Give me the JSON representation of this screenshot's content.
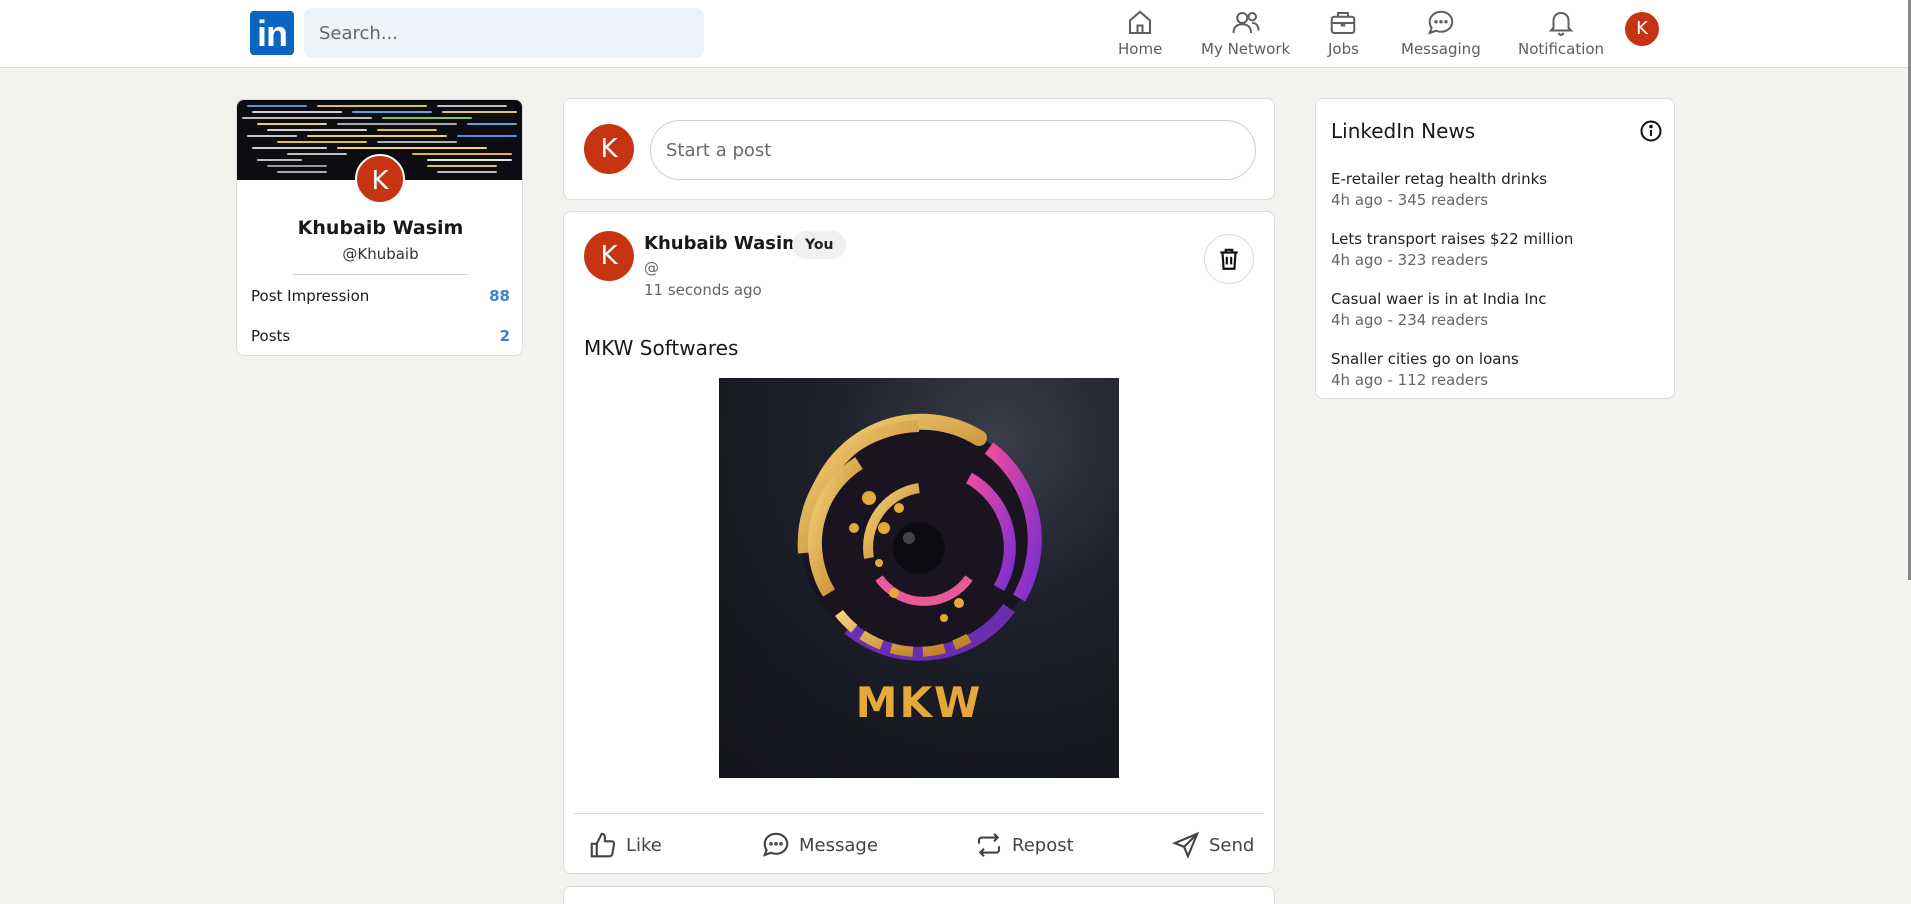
{
  "navbar": {
    "logo_text": "in",
    "search_placeholder": "Search...",
    "items": [
      {
        "label": "Home",
        "icon": "home-icon"
      },
      {
        "label": "My Network",
        "icon": "users-icon"
      },
      {
        "label": "Jobs",
        "icon": "briefcase-icon"
      },
      {
        "label": "Messaging",
        "icon": "chat-icon"
      },
      {
        "label": "Notification",
        "icon": "bell-icon"
      }
    ],
    "avatar_initial": "K"
  },
  "profile": {
    "avatar_initial": "K",
    "name": "Khubaib Wasim",
    "handle": "@Khubaib",
    "stats": [
      {
        "label": "Post Impression",
        "value": "88"
      },
      {
        "label": "Posts",
        "value": "2"
      }
    ]
  },
  "composer": {
    "avatar_initial": "K",
    "placeholder": "Start a post"
  },
  "post": {
    "avatar_initial": "K",
    "author": "Khubaib Wasim",
    "badge": "You",
    "at": "@",
    "time": "11 seconds ago",
    "text": "MKW Softwares",
    "image_text": "MKW",
    "actions": [
      {
        "label": "Like",
        "icon": "thumbs-up-icon"
      },
      {
        "label": "Message",
        "icon": "comment-icon"
      },
      {
        "label": "Repost",
        "icon": "repost-icon"
      },
      {
        "label": "Send",
        "icon": "send-icon"
      }
    ]
  },
  "news": {
    "title": "LinkedIn News",
    "items": [
      {
        "headline": "E-retailer retag health drinks",
        "meta": "4h ago - 345 readers"
      },
      {
        "headline": "Lets transport raises $22 million",
        "meta": "4h ago - 323 readers"
      },
      {
        "headline": "Casual waer is in at India Inc",
        "meta": "4h ago - 234 readers"
      },
      {
        "headline": "Snaller cities go on loans",
        "meta": "4h ago - 112 readers"
      }
    ]
  },
  "colors": {
    "brand": "#0a66c2",
    "avatar": "#c73412",
    "stat_value": "#3b82d6",
    "page_bg": "#f3f2ef"
  }
}
